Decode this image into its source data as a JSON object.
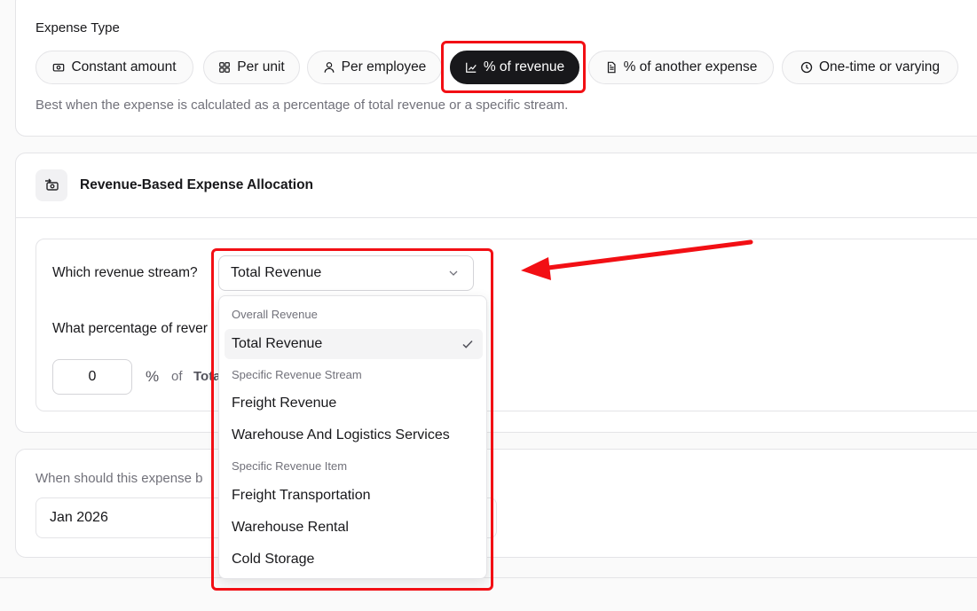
{
  "expense_type": {
    "label": "Expense Type",
    "options": [
      {
        "label": "Constant amount",
        "icon": "cash-icon",
        "active": false
      },
      {
        "label": "Per unit",
        "icon": "grid-icon",
        "active": false
      },
      {
        "label": "Per employee",
        "icon": "user-icon",
        "active": false
      },
      {
        "label": "% of revenue",
        "icon": "chart-icon",
        "active": true
      },
      {
        "label": "% of another expense",
        "icon": "document-icon",
        "active": false
      },
      {
        "label": "One-time or varying",
        "icon": "clock-icon",
        "active": false
      }
    ],
    "helper": "Best when the expense is calculated as a percentage of total revenue or a specific stream."
  },
  "allocation": {
    "title": "Revenue-Based Expense Allocation",
    "icon": "money-transfer-icon",
    "stream_question": "Which revenue stream?",
    "stream_selected": "Total Revenue",
    "percentage_question": "What percentage of rever",
    "percentage_value": "0",
    "percent_sign": "%",
    "of_label": "of",
    "of_target": "Tota"
  },
  "timing": {
    "question": "When should this expense b",
    "start_date": "Jan 2026"
  },
  "dropdown": {
    "groups": [
      {
        "label": "Overall Revenue",
        "items": [
          {
            "label": "Total Revenue",
            "selected": true
          }
        ]
      },
      {
        "label": "Specific Revenue Stream",
        "items": [
          {
            "label": "Freight Revenue"
          },
          {
            "label": "Warehouse And Logistics Services"
          }
        ]
      },
      {
        "label": "Specific Revenue Item",
        "items": [
          {
            "label": "Freight Transportation"
          },
          {
            "label": "Warehouse Rental"
          },
          {
            "label": "Cold Storage"
          }
        ]
      }
    ]
  },
  "colors": {
    "highlight": "#f20f14",
    "active_pill": "#18181b",
    "border": "#e4e4e7",
    "muted_text": "#71717a"
  }
}
